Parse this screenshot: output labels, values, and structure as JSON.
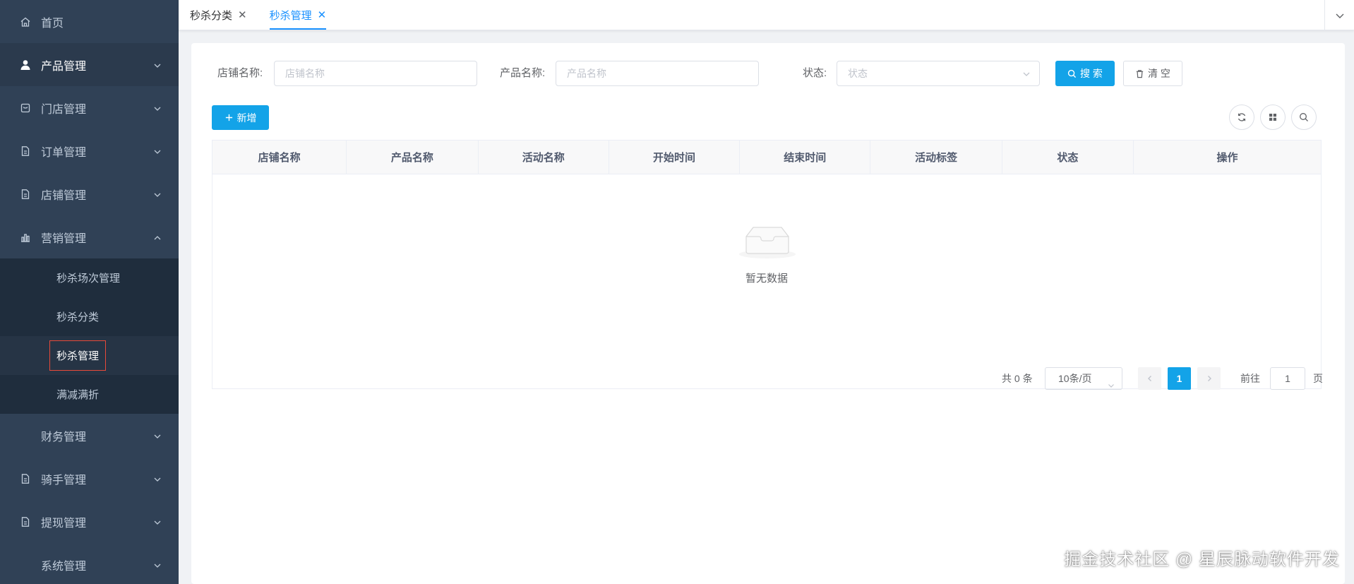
{
  "colors": {
    "sidebar_bg": "#304156",
    "submenu_bg": "#1f2d3d",
    "accent": "#1890ff",
    "primary_button": "#13a3e8"
  },
  "sidebar": {
    "items": [
      {
        "label": "首页",
        "icon": "home-icon"
      },
      {
        "label": "产品管理",
        "icon": "user-icon"
      },
      {
        "label": "门店管理",
        "icon": "store-icon"
      },
      {
        "label": "订单管理",
        "icon": "document-icon"
      },
      {
        "label": "店铺管理",
        "icon": "document-icon"
      },
      {
        "label": "营销管理",
        "icon": "chart-icon"
      },
      {
        "label": "财务管理",
        "icon": ""
      },
      {
        "label": "骑手管理",
        "icon": "document-icon"
      },
      {
        "label": "提现管理",
        "icon": "document-icon"
      },
      {
        "label": "系统管理",
        "icon": ""
      }
    ],
    "marketing_children": [
      {
        "label": "秒杀场次管理"
      },
      {
        "label": "秒杀分类"
      },
      {
        "label": "秒杀管理"
      },
      {
        "label": "满减满折"
      }
    ]
  },
  "tabs": [
    {
      "label": "秒杀分类"
    },
    {
      "label": "秒杀管理"
    }
  ],
  "search": {
    "shop_label": "店铺名称:",
    "shop_placeholder": "店铺名称",
    "product_label": "产品名称:",
    "product_placeholder": "产品名称",
    "status_label": "状态:",
    "status_placeholder": "状态",
    "search_button": "搜 索",
    "clear_button": "清 空"
  },
  "toolbar": {
    "add_button": "新增"
  },
  "table": {
    "columns": [
      "店铺名称",
      "产品名称",
      "活动名称",
      "开始时间",
      "结束时间",
      "活动标签",
      "状态",
      "操作"
    ],
    "rows": [],
    "empty_text": "暂无数据"
  },
  "pagination": {
    "total_text": "共 0 条",
    "page_size": "10条/页",
    "current_page": "1",
    "goto_prefix": "前往",
    "goto_value": "1",
    "goto_suffix": "页"
  },
  "watermark": "掘金技术社区 @ 星辰脉动软件开发"
}
